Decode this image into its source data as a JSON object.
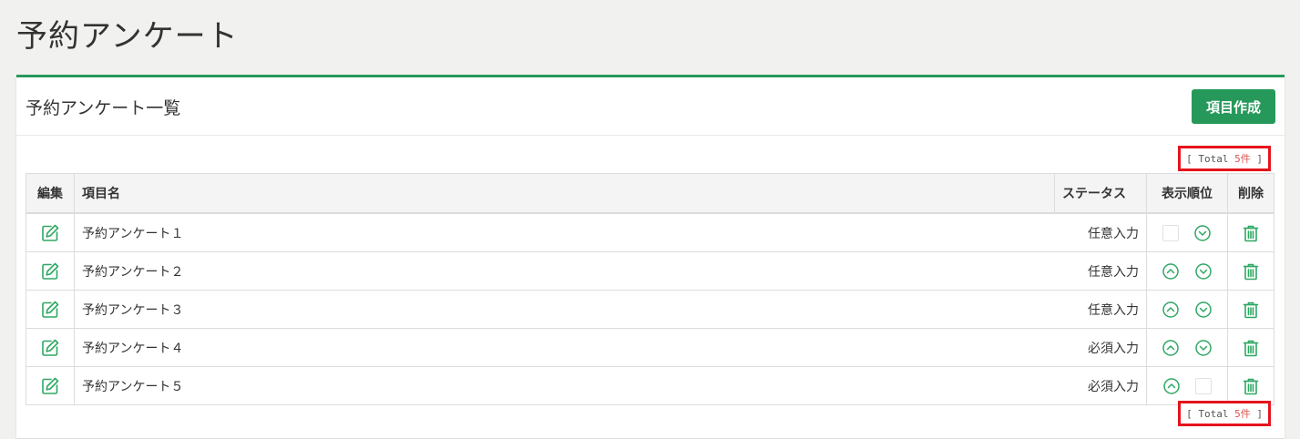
{
  "page": {
    "title": "予約アンケート"
  },
  "panel": {
    "title": "予約アンケート一覧",
    "create_label": "項目作成"
  },
  "total": {
    "prefix": "[ Total ",
    "count": "5件",
    "suffix": " ]"
  },
  "table": {
    "headers": {
      "edit": "編集",
      "name": "項目名",
      "status": "ステータス",
      "order": "表示順位",
      "delete": "削除"
    },
    "rows": [
      {
        "name": "予約アンケート１",
        "status": "任意入力"
      },
      {
        "name": "予約アンケート２",
        "status": "任意入力"
      },
      {
        "name": "予約アンケート３",
        "status": "任意入力"
      },
      {
        "name": "予約アンケート４",
        "status": "必須入力"
      },
      {
        "name": "予約アンケート５",
        "status": "必須入力"
      }
    ]
  },
  "icons": {
    "edit": "edit-icon",
    "up": "arrow-up-circle-icon",
    "down": "arrow-down-circle-icon",
    "delete": "trash-icon"
  },
  "colors": {
    "accent": "#26995a",
    "highlight": "#e4141e",
    "count": "#d9534f"
  }
}
